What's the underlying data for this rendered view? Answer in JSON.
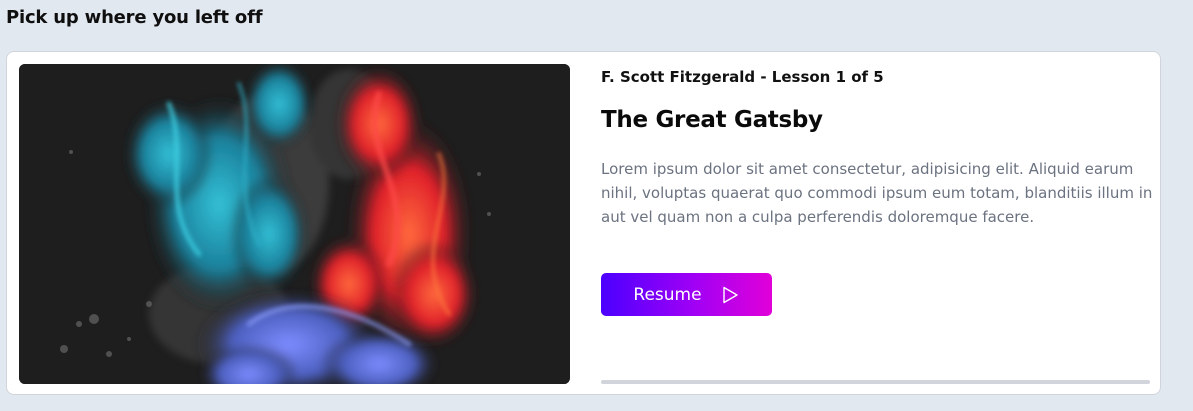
{
  "section": {
    "title": "Pick up where you left off"
  },
  "course": {
    "meta": "F. Scott Fitzgerald - Lesson 1 of 5",
    "title": "The Great Gatsby",
    "description": "Lorem ipsum dolor sit amet consectetur, adipisicing elit. Aliquid earum nihil, voluptas quaerat quo commodi ipsum eum totam, blanditiis illum in aut vel quam non a culpa perferendis doloremque facere.",
    "image": {
      "alt": "Colorful ink smoke artwork",
      "colors": [
        "#1c1c1c",
        "#1a9bb5",
        "#ff3b3b",
        "#5b6fd8"
      ]
    },
    "progress": 0,
    "resume": {
      "label": "Resume",
      "icon": "play-outline-icon"
    }
  },
  "colors": {
    "background": "#e2e8f0",
    "card": "#ffffff",
    "button_gradient_start": "#4b00ff",
    "button_gradient_end": "#e100d8",
    "progress_track": "#d1d5db"
  }
}
